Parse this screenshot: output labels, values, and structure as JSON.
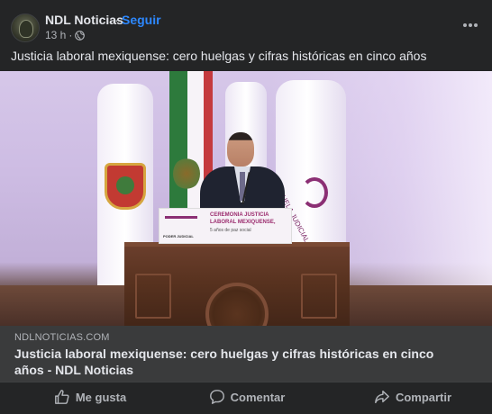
{
  "post": {
    "page_name": "NDL Noticias",
    "separator": "·",
    "follow_label": "Seguir",
    "time": "13 h",
    "meta_separator": "·",
    "text": "Justicia laboral mexiquense: cero huelgas y cifras históricas en cinco años"
  },
  "media": {
    "sign_line1": "CEREMONIA JUSTICIA",
    "sign_line2": "LABORAL MEXIQUENSE,",
    "sign_line3": "5 años de paz social",
    "sign_pj": "PODER JUDICIAL",
    "flag_text": "ESCUELA JUDICIAL"
  },
  "link": {
    "domain": "NDLNOTICIAS.COM",
    "title": "Justicia laboral mexiquense: cero huelgas y cifras históricas en cinco años - NDL Noticias"
  },
  "actions": {
    "like": "Me gusta",
    "comment": "Comentar",
    "share": "Compartir"
  },
  "icons": {
    "avatar": "page-avatar",
    "globe": "globe-icon",
    "more": "more-options-icon",
    "like": "thumbs-up-icon",
    "comment": "comment-bubble-icon",
    "share": "share-arrow-icon"
  },
  "colors": {
    "background": "#242526",
    "link_bar": "#3a3b3c",
    "primary_text": "#e4e6eb",
    "secondary_text": "#b0b3b8",
    "follow": "#2d88ff"
  }
}
